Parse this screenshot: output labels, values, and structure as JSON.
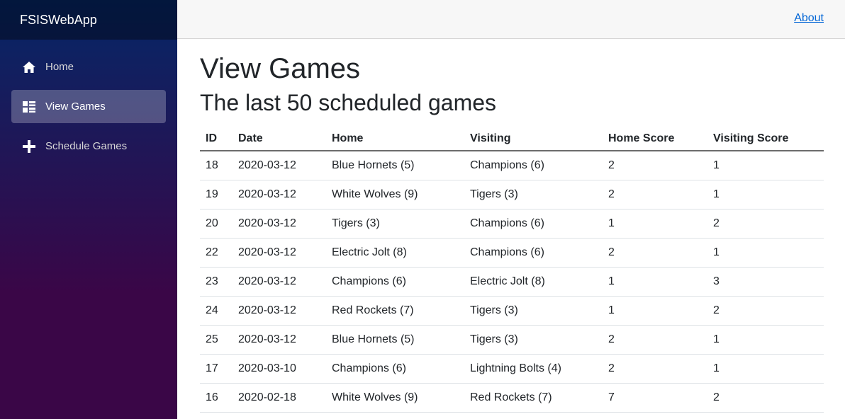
{
  "app": {
    "brand": "FSISWebApp"
  },
  "sidebar": {
    "items": [
      {
        "label": "Home",
        "icon": "home-icon",
        "active": false
      },
      {
        "label": "View Games",
        "icon": "list-icon",
        "active": true
      },
      {
        "label": "Schedule Games",
        "icon": "plus-icon",
        "active": false
      }
    ]
  },
  "topbar": {
    "about_label": "About"
  },
  "page": {
    "title": "View Games",
    "subtitle": "The last 50 scheduled games"
  },
  "table": {
    "headers": [
      "ID",
      "Date",
      "Home",
      "Visiting",
      "Home Score",
      "Visiting Score"
    ],
    "rows": [
      [
        "18",
        "2020-03-12",
        "Blue Hornets (5)",
        "Champions (6)",
        "2",
        "1"
      ],
      [
        "19",
        "2020-03-12",
        "White Wolves (9)",
        "Tigers (3)",
        "2",
        "1"
      ],
      [
        "20",
        "2020-03-12",
        "Tigers (3)",
        "Champions (6)",
        "1",
        "2"
      ],
      [
        "22",
        "2020-03-12",
        "Electric Jolt (8)",
        "Champions (6)",
        "2",
        "1"
      ],
      [
        "23",
        "2020-03-12",
        "Champions (6)",
        "Electric Jolt (8)",
        "1",
        "3"
      ],
      [
        "24",
        "2020-03-12",
        "Red Rockets (7)",
        "Tigers (3)",
        "1",
        "2"
      ],
      [
        "25",
        "2020-03-12",
        "Blue Hornets (5)",
        "Tigers (3)",
        "2",
        "1"
      ],
      [
        "17",
        "2020-03-10",
        "Champions (6)",
        "Lightning Bolts (4)",
        "2",
        "1"
      ],
      [
        "16",
        "2020-02-18",
        "White Wolves (9)",
        "Red Rockets (7)",
        "7",
        "2"
      ]
    ]
  },
  "colors": {
    "sidebar_top": "#052767",
    "sidebar_bottom": "#3a0647",
    "link": "#0366d6"
  }
}
